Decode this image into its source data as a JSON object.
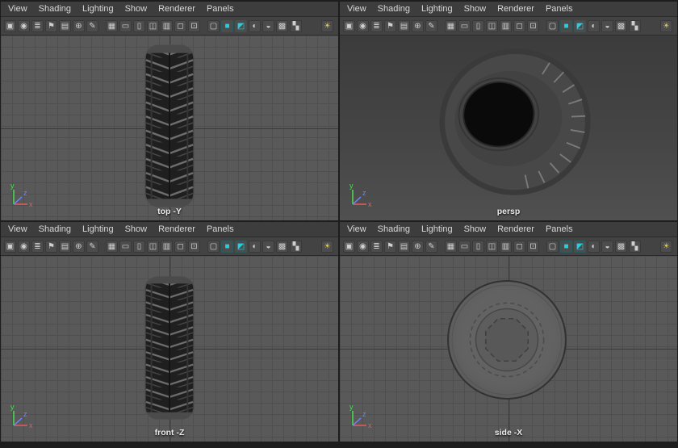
{
  "menubar": {
    "items": [
      {
        "label": "View",
        "name": "menu-view"
      },
      {
        "label": "Shading",
        "name": "menu-shading"
      },
      {
        "label": "Lighting",
        "name": "menu-lighting"
      },
      {
        "label": "Show",
        "name": "menu-show"
      },
      {
        "label": "Renderer",
        "name": "menu-renderer"
      },
      {
        "label": "Panels",
        "name": "menu-panels"
      }
    ]
  },
  "toolbar": {
    "icons": [
      {
        "name": "select-camera-icon",
        "glyph": "▣"
      },
      {
        "name": "lock-camera-icon",
        "glyph": "◉"
      },
      {
        "name": "camera-attributes-icon",
        "glyph": "≣"
      },
      {
        "name": "bookmark-icon",
        "glyph": "⚑"
      },
      {
        "name": "image-plane-icon",
        "glyph": "▤"
      },
      {
        "name": "pan-zoom-icon",
        "glyph": "⊕"
      },
      {
        "name": "grease-pencil-icon",
        "glyph": "✎"
      },
      {
        "name": "toolbar-separator",
        "glyph": "",
        "cls": "sep",
        "interactable": false
      },
      {
        "name": "grid-icon",
        "glyph": "▦"
      },
      {
        "name": "film-gate-icon",
        "glyph": "▭"
      },
      {
        "name": "resolution-gate-icon",
        "glyph": "▯"
      },
      {
        "name": "gate-mask-icon",
        "glyph": "◫"
      },
      {
        "name": "field-chart-icon",
        "glyph": "▥"
      },
      {
        "name": "safe-action-icon",
        "glyph": "◻"
      },
      {
        "name": "safe-title-icon",
        "glyph": "⊡"
      },
      {
        "name": "toolbar-separator",
        "glyph": "",
        "cls": "sep",
        "interactable": false
      },
      {
        "name": "wireframe-icon",
        "glyph": "▢"
      },
      {
        "name": "shaded-icon",
        "glyph": "■",
        "cls": "teal"
      },
      {
        "name": "textured-icon",
        "glyph": "◩",
        "cls": "teal"
      },
      {
        "name": "use-lights-icon",
        "glyph": "◐"
      },
      {
        "name": "shadows-icon",
        "glyph": "◒"
      },
      {
        "name": "ao-icon",
        "glyph": "▩"
      },
      {
        "name": "checker-icon",
        "glyph": "▚"
      },
      {
        "name": "default-light-bulb-icon",
        "glyph": "☀",
        "cls": "bulb",
        "color": "#ddc75a"
      }
    ]
  },
  "viewports": {
    "top": {
      "label": "top -Y"
    },
    "persp": {
      "label": "persp"
    },
    "front": {
      "label": "front -Z"
    },
    "side": {
      "label": "side -X"
    }
  },
  "axis": {
    "x": "x",
    "y": "y",
    "z": "z"
  },
  "colors": {
    "accent_teal": "#25cfe0",
    "viewport_bg": "#595959",
    "panel_bg": "#3d3d3d",
    "grid_line": "#4f4f4f"
  }
}
